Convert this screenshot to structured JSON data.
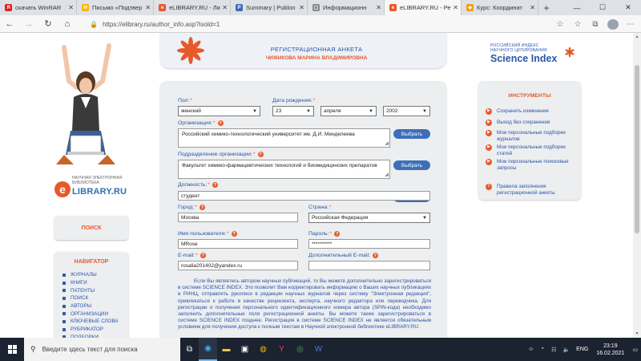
{
  "browser": {
    "tabs": [
      {
        "label": "скачать WinRAR",
        "fav_color": "#e02020",
        "fav_glyph": "Я",
        "active": false
      },
      {
        "label": "Письмо «Подтвер",
        "fav_color": "#ffb300",
        "fav_glyph": "✉",
        "active": false
      },
      {
        "label": "eLIBRARY.RU - Ли",
        "fav_color": "#e8592a",
        "fav_glyph": "e",
        "active": false
      },
      {
        "label": "Summary | Publon",
        "fav_color": "#3a6db5",
        "fav_glyph": "P",
        "active": false
      },
      {
        "label": "Информационн",
        "fav_color": "#888888",
        "fav_glyph": "▢",
        "active": false
      },
      {
        "label": "eLIBRARY.RU - Ре",
        "fav_color": "#e8592a",
        "fav_glyph": "e",
        "active": true
      },
      {
        "label": "Курс: Координат",
        "fav_color": "#f39c12",
        "fav_glyph": "◆",
        "active": false
      }
    ],
    "url": "https://elibrary.ru/author_info.asp?isold=1"
  },
  "left": {
    "logo_caption": "НАУЧНАЯ ЭЛЕКТРОННАЯ БИБЛИОТЕКА",
    "logo_text": "LIBRARY.RU",
    "search_label": "ПОИСК",
    "navigator_title": "НАВИГАТОР",
    "nav_items": [
      "ЖУРНАЛЫ",
      "КНИГИ",
      "ПАТЕНТЫ",
      "ПОИСК",
      "АВТОРЫ",
      "ОРГАНИЗАЦИИ",
      "КЛЮЧЕВЫЕ СЛОВА",
      "РУБРИКАТОР",
      "ПОДБОРКИ"
    ]
  },
  "banner": {
    "title": "РЕГИСТРАЦИОННАЯ АНКЕТА",
    "name": "ЧИЖИКОВА МАРИНА ВЛАДИМИРОВНА"
  },
  "form": {
    "gender_label": "Пол:",
    "gender_value": "женский",
    "birth_label": "Дата рождения:",
    "birth_day": "23",
    "birth_month": "апреля",
    "birth_year": "2002",
    "org_label": "Организация:",
    "org_value": "Российский химико-технологический университет им. Д.И. Менделеева",
    "org_button": "Выбрать",
    "dept_label": "Подразделение организации:",
    "dept_value": "Факультет химико-фармацевтических технологий и биомедицинских препаратов",
    "dept_button": "Выбрать",
    "position_label": "Должность:",
    "position_value": "студент",
    "city_label": "Город:",
    "city_value": "Москва",
    "country_label": "Страна:",
    "country_value": "Российская Федерация",
    "username_label": "Имя пользователя:",
    "username_value": "MRose",
    "password_label": "Пароль:",
    "password_value": "**********",
    "email_label": "E-mail:",
    "email_value": "rosalia201402@yandex.ru",
    "email2_label": "Дополнительный E-mail:",
    "email2_value": "",
    "info_text": "Если Вы являетесь автором научных публикаций, то Вы можете дополнительно зарегистрироваться в системе SCIENCE INDEX. Это позволит Вам корректировать информацию о Ваших научных публикациях в РИНЦ, отправлять рукописи в редакции научных журналов через систему \"Электронная редакция\", привлекаться к работе в качестве рецензента, эксперта, научного редактора или переводчика. Для регистрации и получения персонального идентификационного номера автора (SPIN-кода) необходимо заполнить дополнительные поля регистрационной анкеты. Вы можете также зарегистрироваться в системе SCIENCE INDEX позднее. Регистрация в системе SCIENCE INDEX не является обязательным условием для получения доступа к полным текстам в Научной электронной библиотеке eLIBRARY.RU."
  },
  "right": {
    "sci_small": "РОССИЙСКИЙ ИНДЕКС НАУЧНОГО ЦИТИРОВАНИЯ",
    "sci_big": "Science Index",
    "tools_title": "ИНСТРУМЕНТЫ",
    "tools": [
      {
        "label": "Сохранить изменения"
      },
      {
        "label": "Выход без сохранения"
      },
      {
        "label": "Мои персональные подборки журналов"
      },
      {
        "label": "Мои персональные подборки статей"
      },
      {
        "label": "Мои персональные поисковые запросы"
      }
    ],
    "rules_label": "Правила заполнения регистрационной анкеты"
  },
  "taskbar": {
    "search_placeholder": "Введите здесь текст для поиска",
    "lang": "ENG",
    "time": "23:19",
    "date": "16.02.2021"
  },
  "colors": {
    "accent_orange": "#e8592a",
    "link_blue": "#2a55a8",
    "button_blue": "#3c6fb8",
    "panel_grey": "#eceef0"
  }
}
